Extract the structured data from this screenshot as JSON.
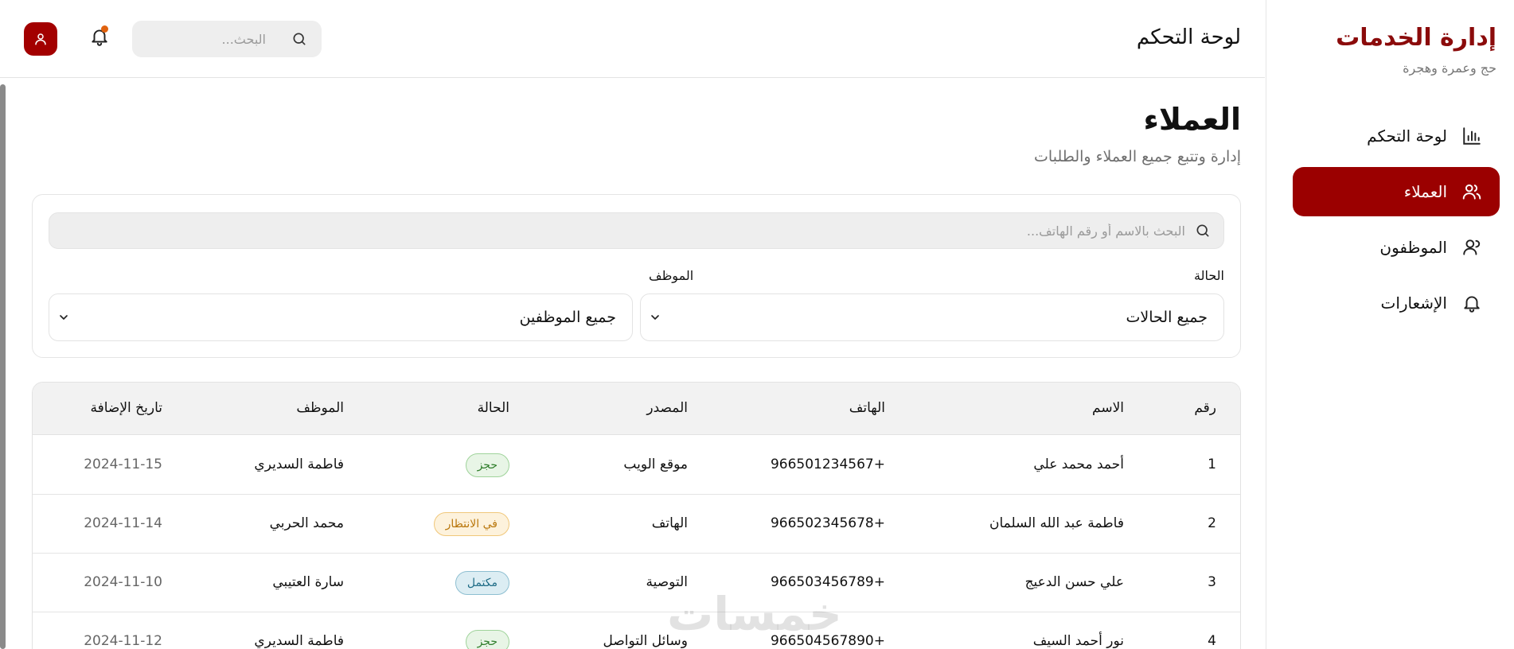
{
  "brand": {
    "title": "إدارة الخدمات",
    "subtitle": "حج وعمرة وهجرة"
  },
  "sidebar": {
    "items": [
      {
        "label": "لوحة التحكم",
        "icon": "bar-chart-icon",
        "active": false
      },
      {
        "label": "العملاء",
        "icon": "users-icon",
        "active": true
      },
      {
        "label": "الموظفون",
        "icon": "user-icon",
        "active": false
      },
      {
        "label": "الإشعارات",
        "icon": "bell-icon",
        "active": false
      }
    ]
  },
  "header": {
    "title": "لوحة التحكم",
    "search_placeholder": "البحث..."
  },
  "page": {
    "title": "العملاء",
    "subtitle": "إدارة وتتبع جميع العملاء والطلبات"
  },
  "filters": {
    "search_placeholder": "البحث بالاسم أو رقم الهاتف...",
    "status_label": "الحالة",
    "status_value": "جميع الحالات",
    "employee_label": "الموظف",
    "employee_value": "جميع الموظفين"
  },
  "table": {
    "headers": {
      "num": "رقم",
      "name": "الاسم",
      "phone": "الهاتف",
      "source": "المصدر",
      "status": "الحالة",
      "employee": "الموظف",
      "date": "تاريخ الإضافة"
    },
    "rows": [
      {
        "num": "1",
        "name": "أحمد محمد علي",
        "phone": "966501234567+",
        "source": "موقع الويب",
        "status": "حجز",
        "status_type": "booked",
        "employee": "فاطمة السديري",
        "date": "2024-11-15"
      },
      {
        "num": "2",
        "name": "فاطمة عبد الله السلمان",
        "phone": "966502345678+",
        "source": "الهاتف",
        "status": "في الانتظار",
        "status_type": "pending",
        "employee": "محمد الحربي",
        "date": "2024-11-14"
      },
      {
        "num": "3",
        "name": "علي حسن الدعيج",
        "phone": "966503456789+",
        "source": "التوصية",
        "status": "مكتمل",
        "status_type": "done",
        "employee": "سارة العتيبي",
        "date": "2024-11-10"
      },
      {
        "num": "4",
        "name": "نور أحمد السيف",
        "phone": "966504567890+",
        "source": "وسائل التواصل",
        "status": "حجز",
        "status_type": "booked",
        "employee": "فاطمة السديري",
        "date": "2024-11-12"
      }
    ]
  },
  "watermark": "خمسات",
  "colors": {
    "accent": "#9b0000",
    "brand": "#8b0b0b",
    "notification_dot": "#e0620e"
  }
}
